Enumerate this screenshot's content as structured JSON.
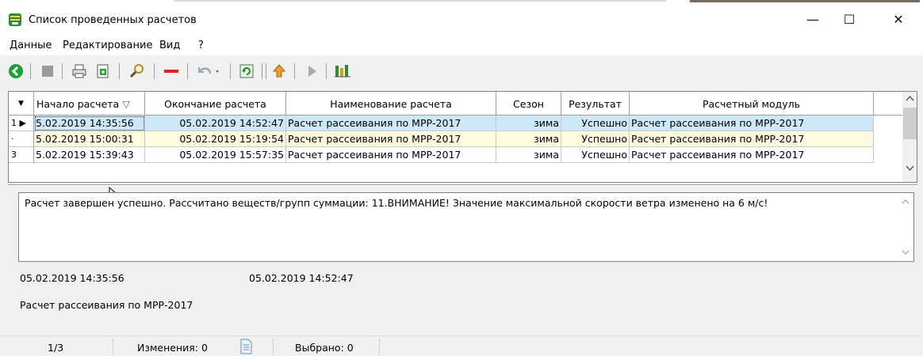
{
  "window": {
    "title": "Список проведенных расчетов",
    "controls": {
      "minimize": "—",
      "maximize": "☐",
      "close": "✕"
    }
  },
  "menu": [
    "Данные",
    "Редактирование",
    "Вид",
    "?"
  ],
  "toolbar": {
    "icons": [
      "back-icon",
      "stop-icon",
      "print-icon",
      "export-icon",
      "search-icon",
      "delete-icon",
      "undo-icon",
      "refresh-icon",
      "upload-icon",
      "play-icon",
      "calc-icon"
    ]
  },
  "grid": {
    "columns": [
      "Начало расчета",
      "Окончание расчета",
      "Наименование расчета",
      "Сезон",
      "Результат",
      "Расчетный модуль"
    ],
    "sort_glyph": "▽",
    "rows": [
      {
        "indicator": "1 ▶",
        "start": "5.02.2019 14:35:56",
        "end": "05.02.2019 14:52:47",
        "name": "Расчет рассеивания по МРР-2017",
        "season": "зима",
        "result": "Успешно",
        "module": "Расчет рассеивания по МРР-2017",
        "selected": true
      },
      {
        "indicator": "·",
        "start": "5.02.2019 15:00:31",
        "end": "05.02.2019 15:19:54",
        "name": "Расчет рассеивания по МРР-2017",
        "season": "зима",
        "result": "Успешно",
        "module": "Расчет рассеивания по МРР-2017",
        "selected": false
      },
      {
        "indicator": "3",
        "start": "5.02.2019 15:39:43",
        "end": "05.02.2019 15:57:35",
        "name": "Расчет рассеивания по МРР-2017",
        "season": "зима",
        "result": "Успешно",
        "module": "Расчет рассеивания по МРР-2017",
        "selected": false
      }
    ]
  },
  "details": {
    "message": "Расчет завершен успешно. Рассчитано веществ/групп суммации: 11.ВНИМАНИЕ! Значение максимальной скорости ветра изменено на 6 м/с!",
    "start": "05.02.2019 14:35:56",
    "end": "05.02.2019 14:52:47",
    "name": "Расчет рассеивания по МРР-2017"
  },
  "status": {
    "position": "1/3",
    "changes": "Изменения: 0",
    "selected": "Выбрано: 0"
  },
  "colors": {
    "selected_row": "#cde8f7",
    "even_row": "#fffce0",
    "back_green": "#1aa336",
    "delete_red": "#e02020"
  }
}
